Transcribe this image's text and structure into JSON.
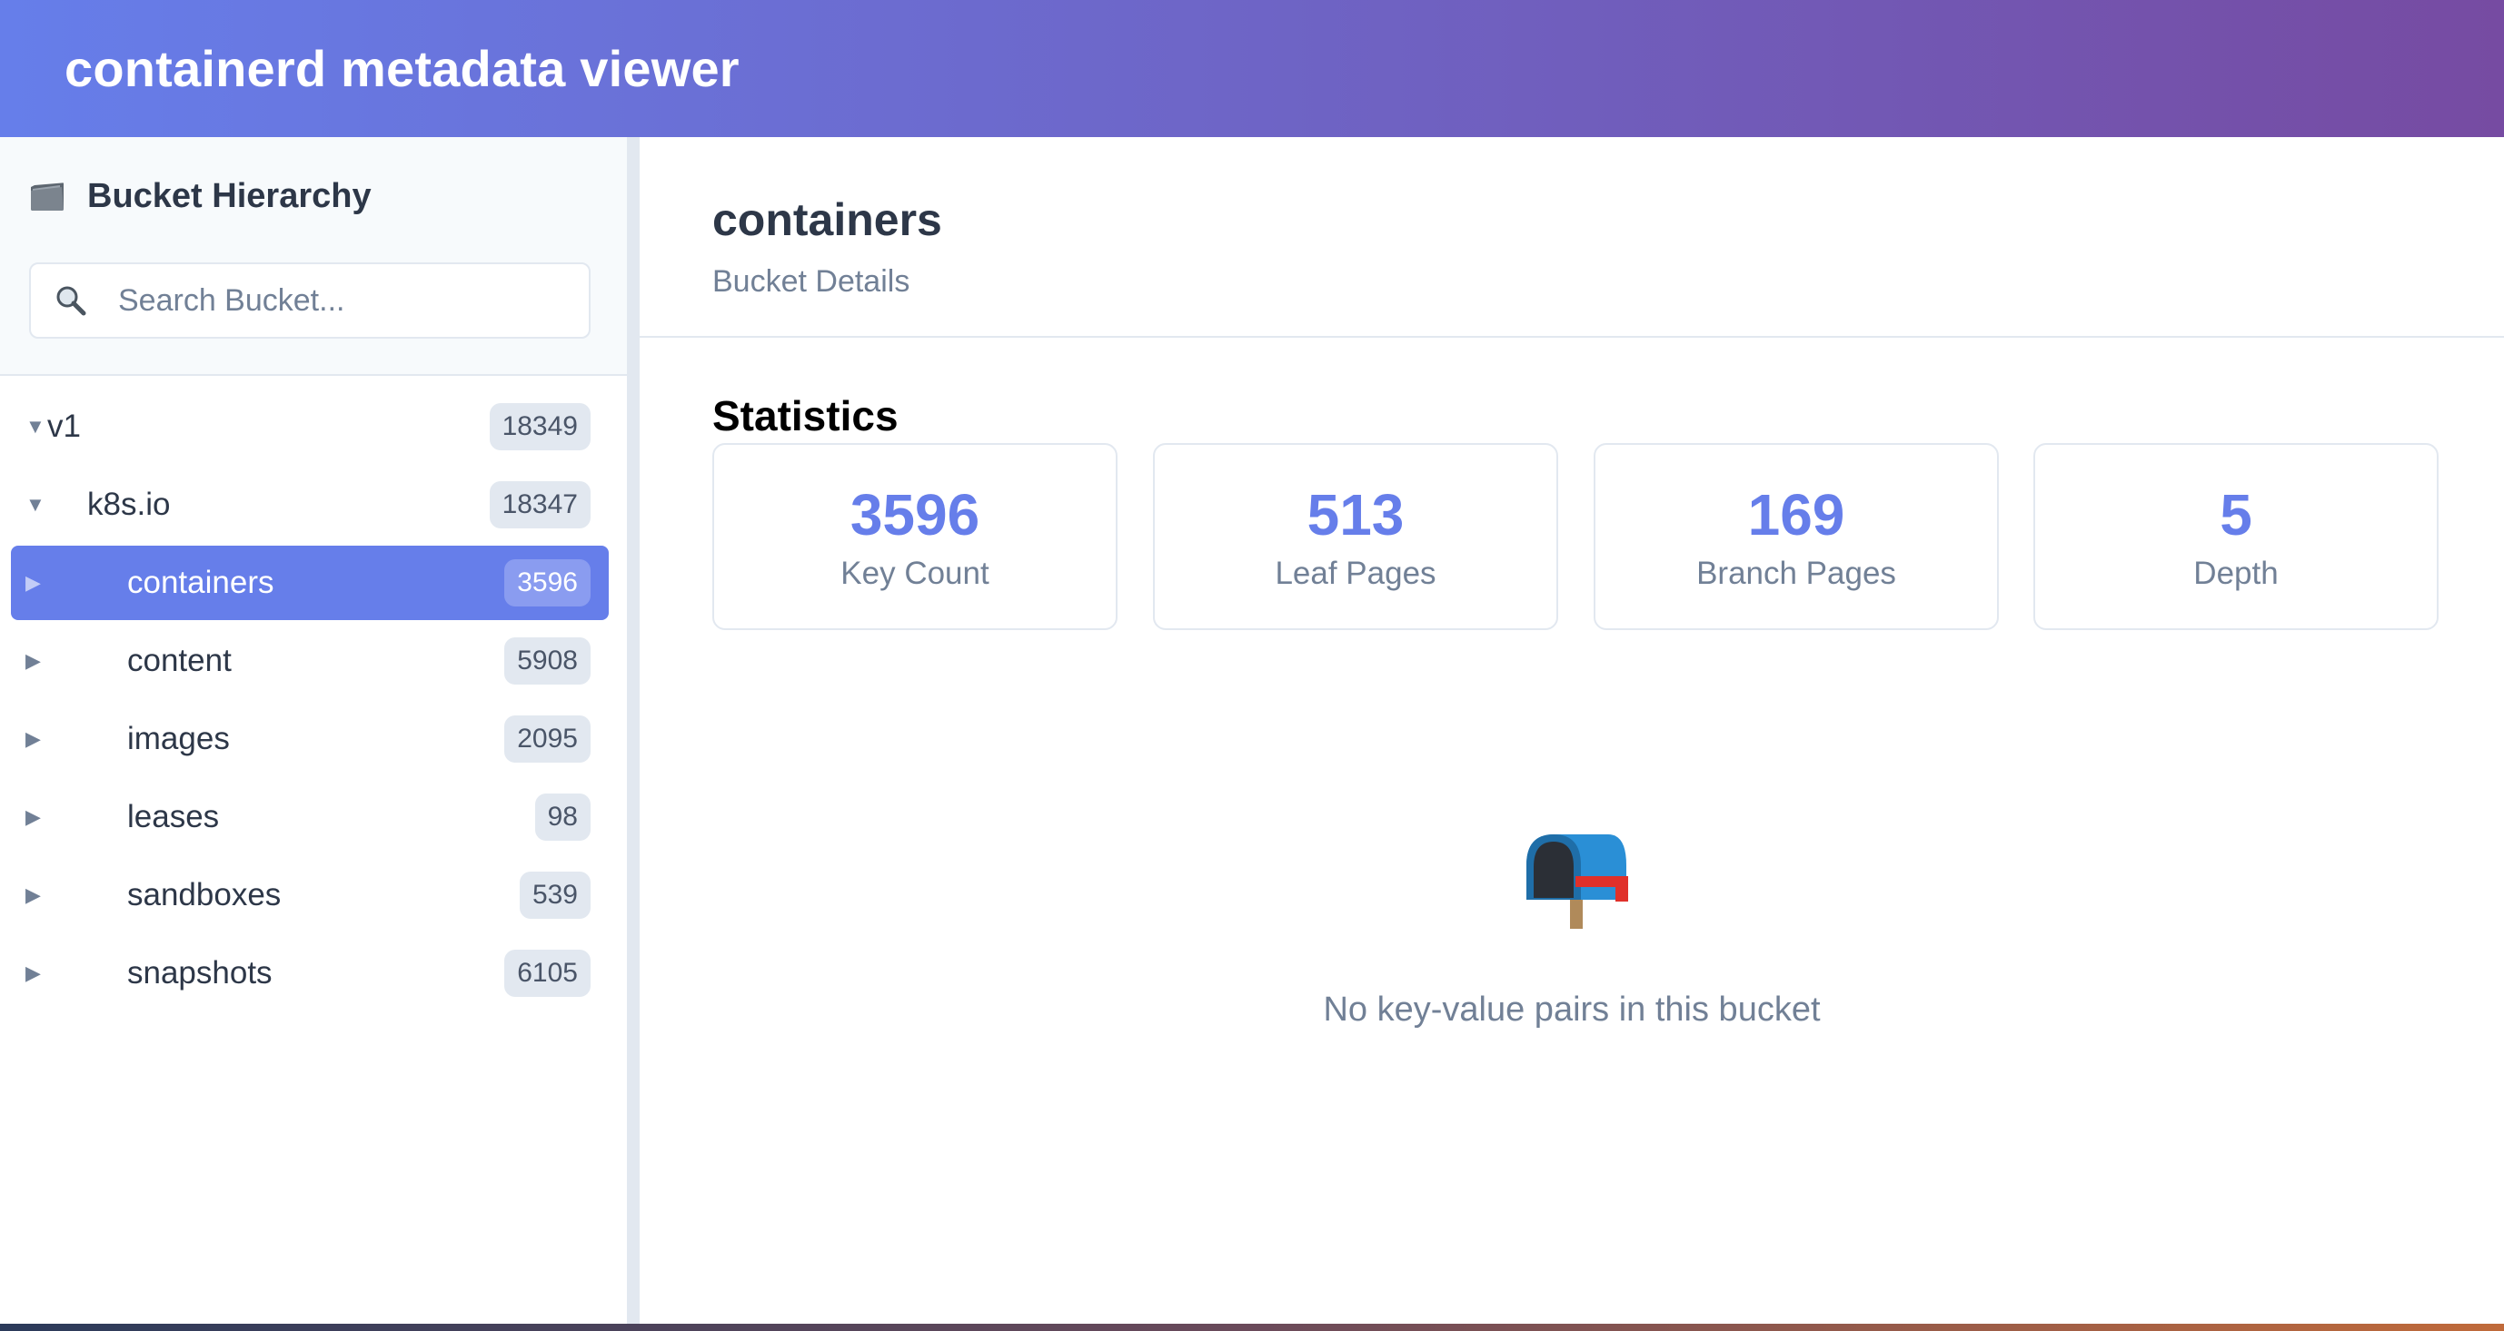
{
  "header": {
    "title": "containerd metadata viewer"
  },
  "sidebar": {
    "title": "Bucket Hierarchy",
    "search": {
      "placeholder": "Search Bucket...",
      "value": ""
    },
    "tree": [
      {
        "label": "v1",
        "count": "18349",
        "expanded": true,
        "selected": false,
        "level": 0
      },
      {
        "label": "k8s.io",
        "count": "18347",
        "expanded": true,
        "selected": false,
        "level": 1
      },
      {
        "label": "containers",
        "count": "3596",
        "expanded": false,
        "selected": true,
        "level": 2
      },
      {
        "label": "content",
        "count": "5908",
        "expanded": false,
        "selected": false,
        "level": 2
      },
      {
        "label": "images",
        "count": "2095",
        "expanded": false,
        "selected": false,
        "level": 2
      },
      {
        "label": "leases",
        "count": "98",
        "expanded": false,
        "selected": false,
        "level": 2
      },
      {
        "label": "sandboxes",
        "count": "539",
        "expanded": false,
        "selected": false,
        "level": 2
      },
      {
        "label": "snapshots",
        "count": "6105",
        "expanded": false,
        "selected": false,
        "level": 2
      }
    ]
  },
  "main": {
    "bucket_name": "containers",
    "subtitle": "Bucket Details",
    "stats_title": "Statistics",
    "stats": [
      {
        "value": "3596",
        "label": "Key Count"
      },
      {
        "value": "513",
        "label": "Leaf Pages"
      },
      {
        "value": "169",
        "label": "Branch Pages"
      },
      {
        "value": "5",
        "label": "Depth"
      }
    ],
    "empty_icon": "mailbox-icon",
    "empty_message": "No key-value pairs in this bucket"
  },
  "colors": {
    "accent": "#667eea",
    "header_gradient_start": "#667eea",
    "header_gradient_end": "#764ba2",
    "muted_text": "#718096"
  }
}
